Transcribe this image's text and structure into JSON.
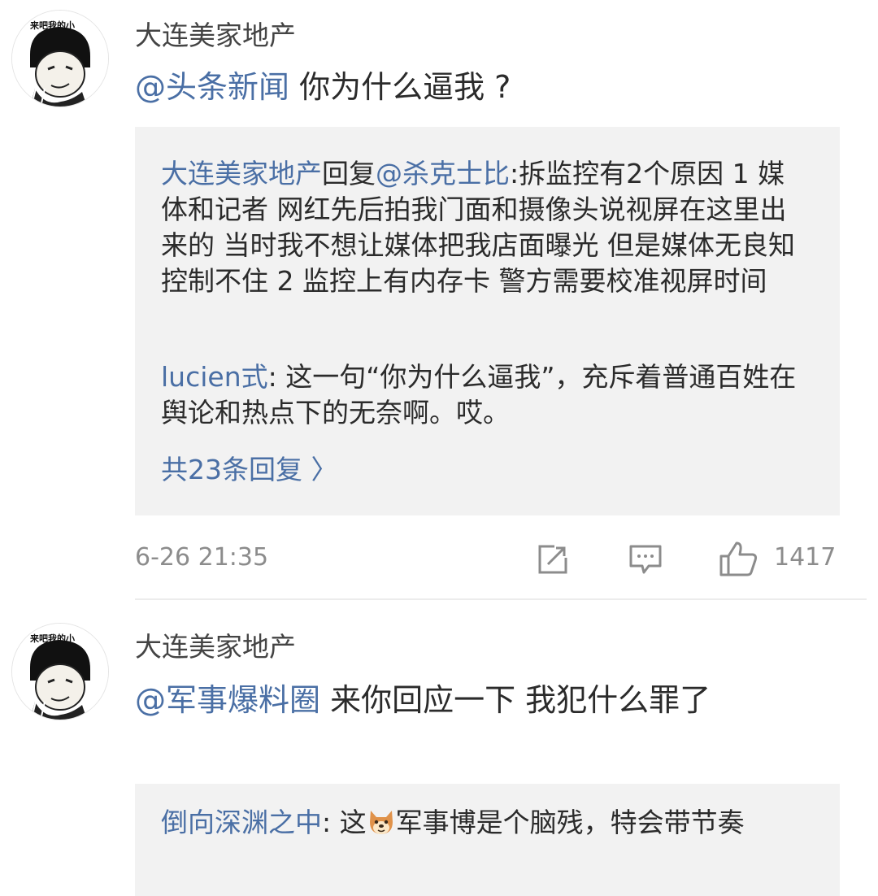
{
  "comments": [
    {
      "author": "大连美家地产",
      "avatar_caption": "来吧我的小",
      "mention": "@头条新闻",
      "text": " 你为什么逼我 ?",
      "reply_box": {
        "reply1": {
          "author": "大连美家地产",
          "verb": "回复",
          "target": "@杀克士比",
          "text": ":拆监控有2个原因  1 媒体和记者 网红先后拍我门面和摄像头说视屏在这里出来的 当时我不想让媒体把我店面曝光 但是媒体无良知 控制不住 2 监控上有内存卡 警方需要校准视屏时间"
        },
        "reply2": {
          "author": "lucien式",
          "text": ": 这一句“你为什么逼我”，充斥着普通百姓在舆论和热点下的无奈啊。哎。"
        },
        "more_label": "共23条回复",
        "more_chevron": "〉"
      },
      "time": "6-26 21:35",
      "like_count": "1417",
      "icons": [
        "share-icon",
        "comment-icon",
        "thumbs-up-icon"
      ]
    },
    {
      "author": "大连美家地产",
      "avatar_caption": "来吧我的小",
      "mention": "@军事爆料圈",
      "text": "  来你回应一下  我犯什么罪了",
      "reply_box": {
        "reply1": {
          "author": "倒向深渊之中",
          "text_before_emoji": ": 这",
          "emoji": "dog-face-emoji",
          "text_after_emoji": "军事博是个脑残，特会带节奏"
        }
      }
    }
  ]
}
